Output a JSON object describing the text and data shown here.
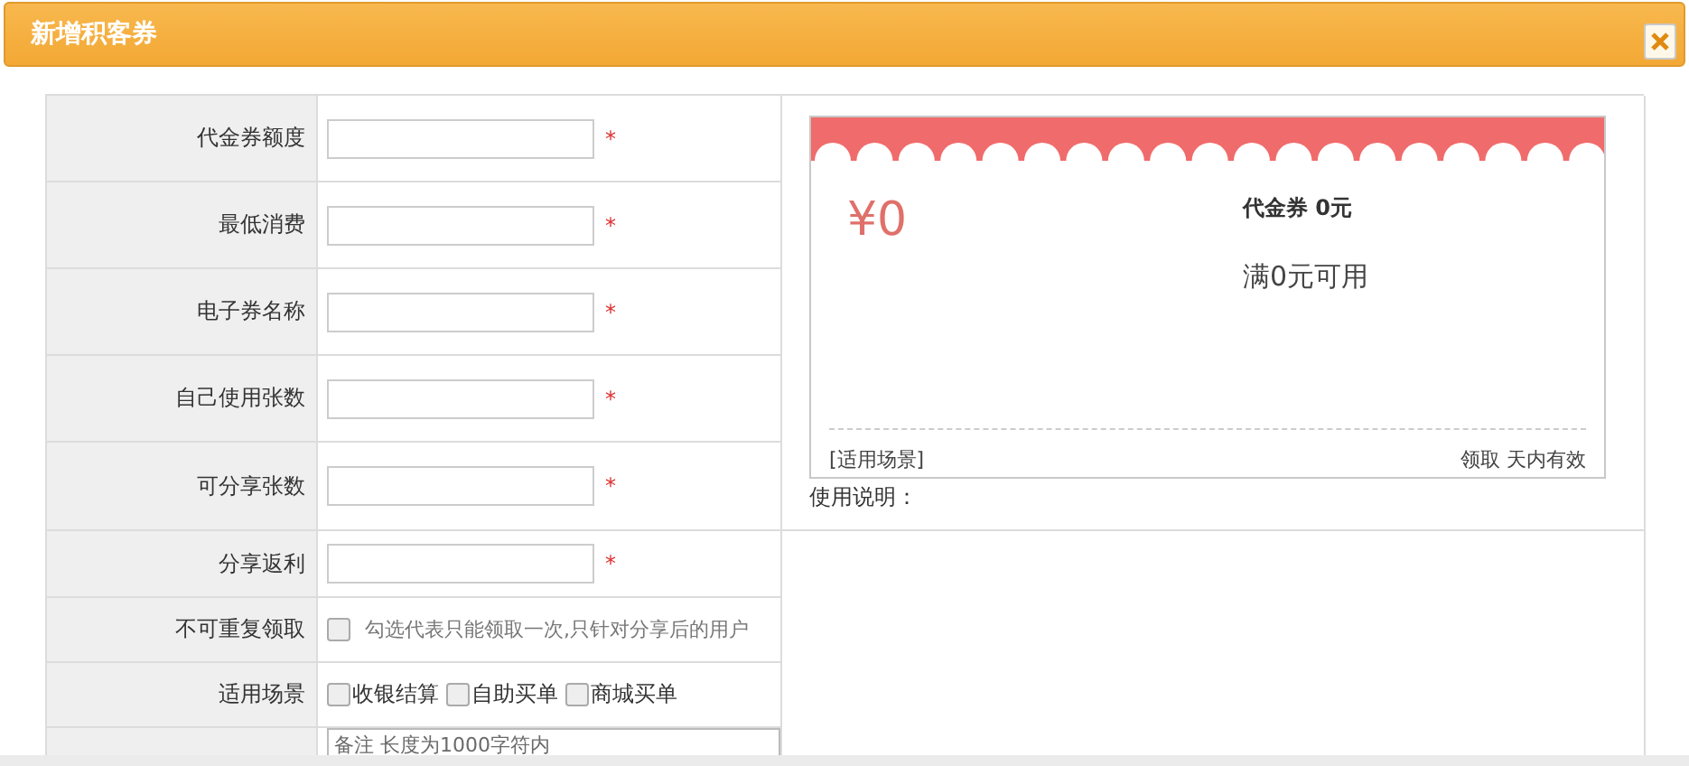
{
  "window": {
    "title": "新增积客券"
  },
  "form": {
    "fields": [
      {
        "kind": "text",
        "label": "代金券额度",
        "required_mark": "*"
      },
      {
        "kind": "text",
        "label": "最低消费",
        "required_mark": "*"
      },
      {
        "kind": "text",
        "label": "电子券名称",
        "required_mark": "*"
      },
      {
        "kind": "text",
        "label": "自己使用张数",
        "required_mark": "*"
      },
      {
        "kind": "text",
        "label": "可分享张数",
        "required_mark": "*"
      },
      {
        "kind": "text",
        "label": "分享返利",
        "required_mark": "*"
      },
      {
        "kind": "checkbox",
        "label": "不可重复领取",
        "checked": false,
        "hint": "勾选代表只能领取一次,只针对分享后的用户"
      },
      {
        "kind": "options",
        "label": "适用场景",
        "options": [
          {
            "label": "收银结算",
            "checked": false
          },
          {
            "label": "自助买单",
            "checked": false
          },
          {
            "label": "商城买单",
            "checked": false
          }
        ]
      },
      {
        "kind": "textarea",
        "placeholder": "备注 长度为1000字符内"
      }
    ]
  },
  "preview": {
    "amount": "¥0",
    "name": "代金券 0元",
    "condition": "满0元可用",
    "scenes": "[适用场景]",
    "validity": "领取 天内有效",
    "usage_label": "使用说明："
  }
}
